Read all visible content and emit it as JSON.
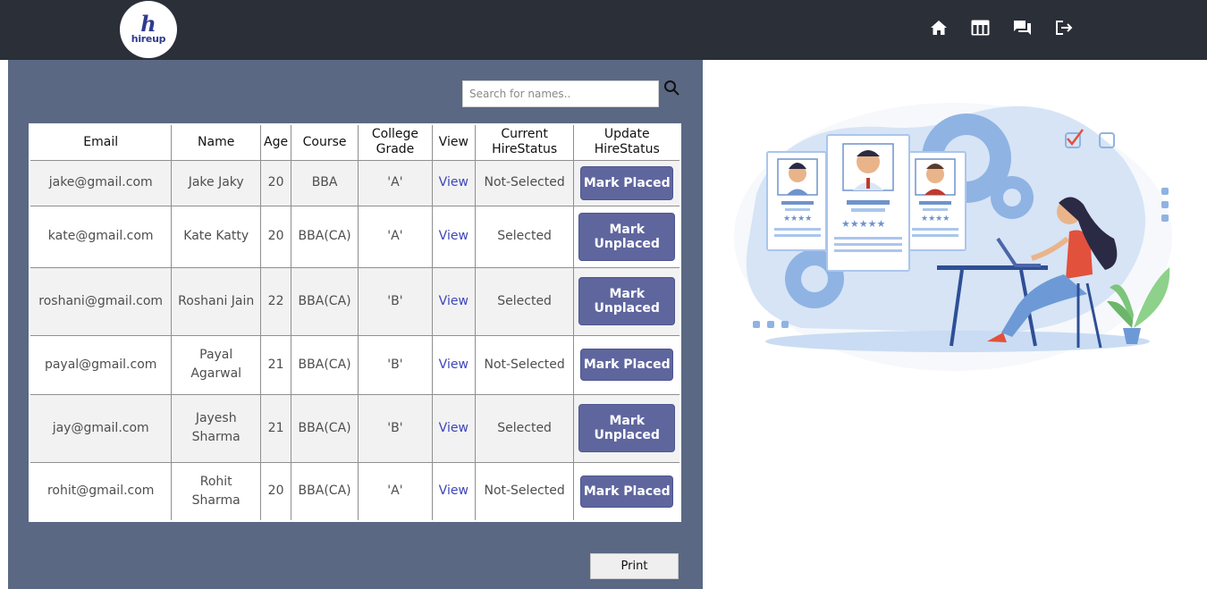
{
  "brand": {
    "logo_mark": "h",
    "logo_text": "hireup"
  },
  "nav": {
    "icons": [
      "home-icon",
      "table-icon",
      "chat-icon",
      "logout-icon"
    ]
  },
  "search": {
    "placeholder": "Search for names.."
  },
  "table": {
    "headers": {
      "email": "Email",
      "name": "Name",
      "age": "Age",
      "course": "Course",
      "grade": "College Grade",
      "view": "View",
      "status": "Current HireStatus",
      "update": "Update HireStatus"
    },
    "rows": [
      {
        "email": "jake@gmail.com",
        "name": "Jake Jaky",
        "age": "20",
        "course": "BBA",
        "grade": "'A'",
        "view": "View",
        "status": "Not-Selected",
        "action": "Mark Placed"
      },
      {
        "email": "kate@gmail.com",
        "name": "Kate Katty",
        "age": "20",
        "course": "BBA(CA)",
        "grade": "'A'",
        "view": "View",
        "status": "Selected",
        "action": "Mark Unplaced"
      },
      {
        "email": "roshani@gmail.com",
        "name": "Roshani Jain",
        "age": "22",
        "course": "BBA(CA)",
        "grade": "'B'",
        "view": "View",
        "status": "Selected",
        "action": "Mark Unplaced"
      },
      {
        "email": "payal@gmail.com",
        "name": "Payal Agarwal",
        "age": "21",
        "course": "BBA(CA)",
        "grade": "'B'",
        "view": "View",
        "status": "Not-Selected",
        "action": "Mark Placed"
      },
      {
        "email": "jay@gmail.com",
        "name": "Jayesh Sharma",
        "age": "21",
        "course": "BBA(CA)",
        "grade": "'B'",
        "view": "View",
        "status": "Selected",
        "action": "Mark Unplaced"
      },
      {
        "email": "rohit@gmail.com",
        "name": "Rohit Sharma",
        "age": "20",
        "course": "BBA(CA)",
        "grade": "'A'",
        "view": "View",
        "status": "Not-Selected",
        "action": "Mark Placed"
      }
    ]
  },
  "print_label": "Print",
  "colors": {
    "navbar": "#2a2f38",
    "panel": "#5a6883",
    "button": "#5f669e",
    "status_not_selected": "#e31b1b",
    "status_selected": "#1d7a1d"
  }
}
